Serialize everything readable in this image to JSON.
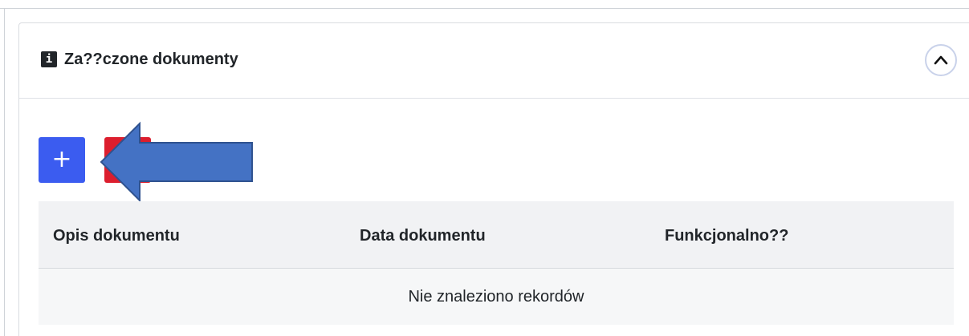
{
  "panel": {
    "title": "Za??czone dokumenty",
    "info_icon_glyph": "i",
    "collapse_icon": "chevron-up-icon"
  },
  "toolbar": {
    "add_label": "+",
    "add_icon": "plus-icon",
    "delete_icon": "delete-icon",
    "add_color": "#3b5cf0",
    "delete_color": "#dc1e2e",
    "annotation_arrow_color": "#4472c4"
  },
  "table": {
    "columns": [
      "Opis dokumentu",
      "Data dokumentu",
      "Funkcjonalno??"
    ],
    "empty_message": "Nie znaleziono rekordów"
  }
}
